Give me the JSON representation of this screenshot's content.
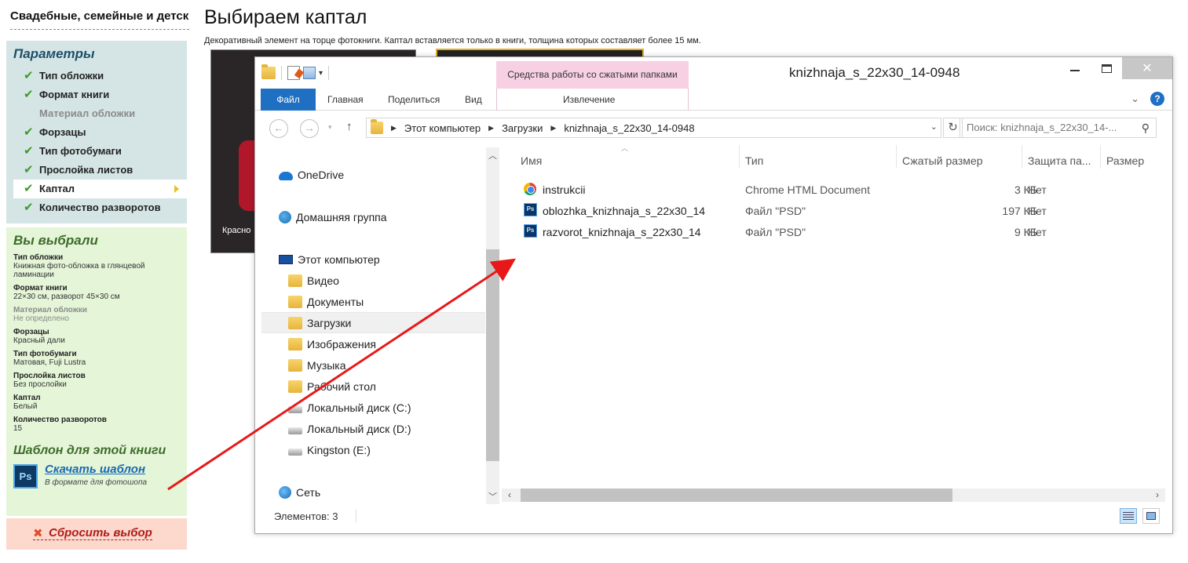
{
  "site": {
    "title": "Свадебные, семейные и детские фотокниги"
  },
  "params": {
    "heading": "Параметры",
    "items": [
      {
        "label": "Тип обложки",
        "state": "done"
      },
      {
        "label": "Формат книги",
        "state": "done"
      },
      {
        "label": "Материал обложки",
        "state": "muted"
      },
      {
        "label": "Форзацы",
        "state": "done"
      },
      {
        "label": "Тип фотобумаги",
        "state": "done"
      },
      {
        "label": "Прослойка листов",
        "state": "done"
      },
      {
        "label": "Каптал",
        "state": "active"
      },
      {
        "label": "Количество разворотов",
        "state": "done"
      }
    ],
    "check_glyph": "✔"
  },
  "chosen": {
    "heading": "Вы выбрали",
    "items": [
      {
        "label": "Тип обложки",
        "value": "Книжная фото-обложка в глянцевой ламинации"
      },
      {
        "label": "Формат книги",
        "value": "22×30 см, разворот 45×30 см"
      },
      {
        "label": "Материал обложки",
        "value": "Не определено"
      },
      {
        "label": "Форзацы",
        "value": "Красный дали"
      },
      {
        "label": "Тип фотобумаги",
        "value": "Матовая, Fuji Lustra"
      },
      {
        "label": "Прослойка листов",
        "value": "Без прослойки"
      },
      {
        "label": "Каптал",
        "value": "Белый"
      },
      {
        "label": "Количество разворотов",
        "value": "15"
      }
    ],
    "template_heading": "Шаблон для этой книги",
    "template_badge": "Ps",
    "template_link": "Скачать шаблон",
    "template_sub": "В формате для фотошопа"
  },
  "reset": {
    "label": "Сбросить выбор",
    "icon": "✖"
  },
  "page": {
    "h1": "Выбираем каптал",
    "desc": "Декоративный элемент на торце фотокниги. Каптал вставляется только в книги, толщина которых составляет более 15 мм.",
    "photo_caption": "Красно"
  },
  "explorer": {
    "tool_context": "Средства работы со сжатыми папками",
    "title": "knizhnaja_s_22x30_14-0948",
    "window_controls": {
      "min": "",
      "max": "",
      "close": "✕"
    },
    "ribbon": {
      "file": "Файл",
      "home": "Главная",
      "share": "Поделиться",
      "view": "Вид",
      "extract": "Извлечение",
      "expand_glyph": "⌄",
      "help_glyph": "?"
    },
    "address": {
      "back_glyph": "←",
      "forward_glyph": "→",
      "up_glyph": "↑",
      "sep_glyph": "▶",
      "crumbs": [
        "Этот компьютер",
        "Загрузки",
        "knizhnaja_s_22x30_14-0948"
      ],
      "refresh_glyph": "↻",
      "search_placeholder": "Поиск: knizhnaja_s_22x30_14-..."
    },
    "nav": [
      {
        "label": "OneDrive",
        "icon": "cloud-icon"
      },
      {
        "label": "Домашняя группа",
        "icon": "homegroup-icon"
      },
      {
        "label": "Этот компьютер",
        "icon": "pc-icon"
      },
      {
        "label": "Видео",
        "icon": "folder-icon"
      },
      {
        "label": "Документы",
        "icon": "folder-icon"
      },
      {
        "label": "Загрузки",
        "icon": "folder-icon",
        "selected": true
      },
      {
        "label": "Изображения",
        "icon": "folder-icon"
      },
      {
        "label": "Музыка",
        "icon": "folder-icon"
      },
      {
        "label": "Рабочий стол",
        "icon": "folder-icon"
      },
      {
        "label": "Локальный диск (C:)",
        "icon": "disk-icon"
      },
      {
        "label": "Локальный диск (D:)",
        "icon": "disk-icon"
      },
      {
        "label": "Kingston (E:)",
        "icon": "disk-icon"
      },
      {
        "label": "Сеть",
        "icon": "network-icon"
      }
    ],
    "columns": {
      "name": "Имя",
      "type": "Тип",
      "compressed": "Сжатый размер",
      "protection": "Защита па...",
      "size": "Размер"
    },
    "files": [
      {
        "name": "instrukcii",
        "type": "Chrome HTML Document",
        "compressed": "3 КБ",
        "protection": "Нет",
        "icon": "chrome-icon"
      },
      {
        "name": "oblozhka_knizhnaja_s_22x30_14",
        "type": "Файл \"PSD\"",
        "compressed": "197 КБ",
        "protection": "Нет",
        "icon": "psd-icon"
      },
      {
        "name": "razvorot_knizhnaja_s_22x30_14",
        "type": "Файл \"PSD\"",
        "compressed": "9 КБ",
        "protection": "Нет",
        "icon": "psd-icon"
      }
    ],
    "file_icon_text": "Ps",
    "status": "Элементов: 3"
  },
  "colors": {
    "params_bg": "#d5e5e5",
    "chosen_bg": "#e5f5d8",
    "reset_bg": "#fcd9cc",
    "accent_blue": "#1f6fc2",
    "arrow_red": "#e81818"
  }
}
